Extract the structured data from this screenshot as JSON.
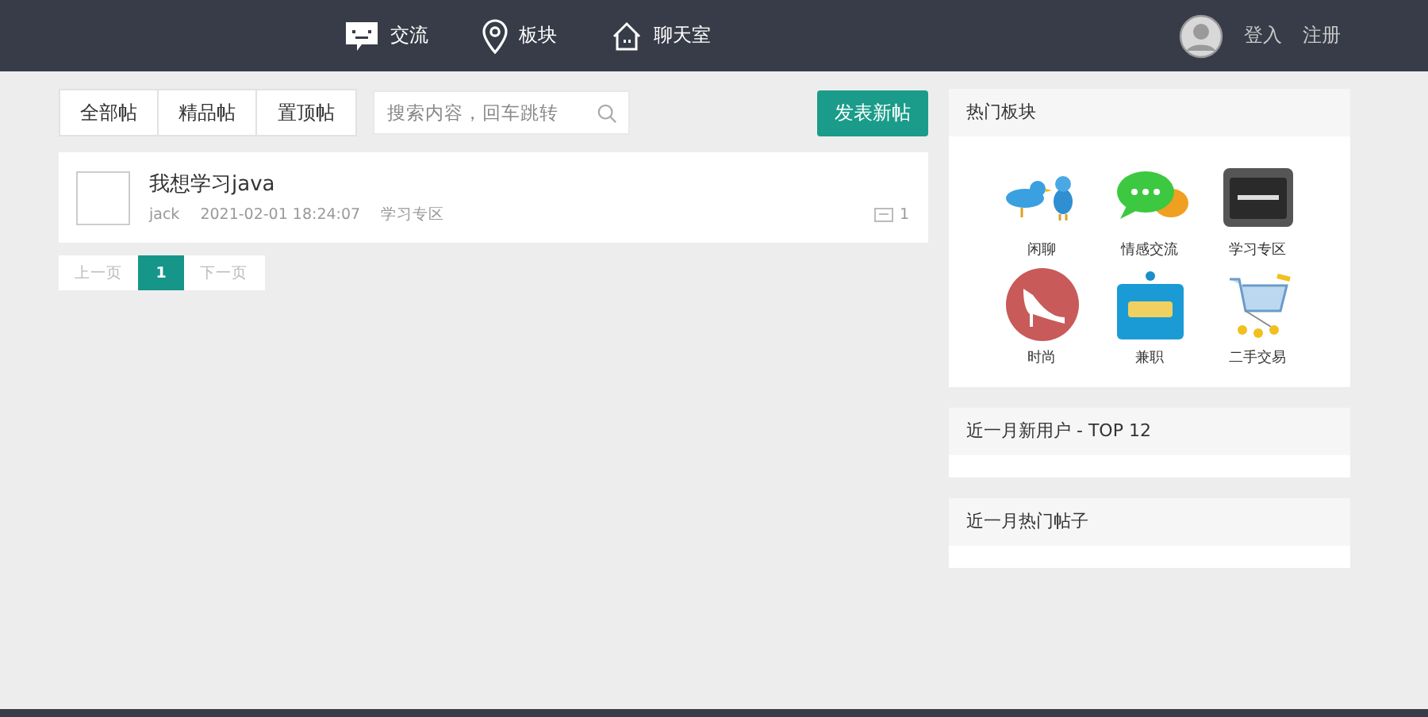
{
  "nav": {
    "items": [
      {
        "kind": "chat",
        "label": "交流"
      },
      {
        "kind": "pin",
        "label": "板块"
      },
      {
        "kind": "house",
        "label": "聊天室"
      }
    ],
    "login": "登入",
    "register": "注册"
  },
  "filters": [
    {
      "label": "全部帖"
    },
    {
      "label": "精品帖"
    },
    {
      "label": "置顶帖"
    }
  ],
  "search": {
    "placeholder": "搜索内容，回车跳转"
  },
  "new_post": "发表新帖",
  "posts": [
    {
      "title": "我想学习java",
      "author": "jack",
      "time": "2021-02-01 18:24:07",
      "board": "学习专区",
      "comments": "1"
    }
  ],
  "pagination": {
    "prev": "上一页",
    "pages": [
      {
        "label": "1",
        "selected": true
      }
    ],
    "next": "下一页"
  },
  "hot_boards": {
    "title": "热门板块",
    "items": [
      {
        "kind": "birds",
        "label": "闲聊"
      },
      {
        "kind": "bubbles",
        "label": "情感交流"
      },
      {
        "kind": "blackboard",
        "label": "学习专区"
      },
      {
        "kind": "shoe",
        "label": "时尚"
      },
      {
        "kind": "job",
        "label": "兼职"
      },
      {
        "kind": "cart",
        "label": "二手交易"
      }
    ]
  },
  "panels": [
    {
      "title": "近一月新用户 - TOP 12"
    },
    {
      "title": "近一月热门帖子"
    }
  ]
}
